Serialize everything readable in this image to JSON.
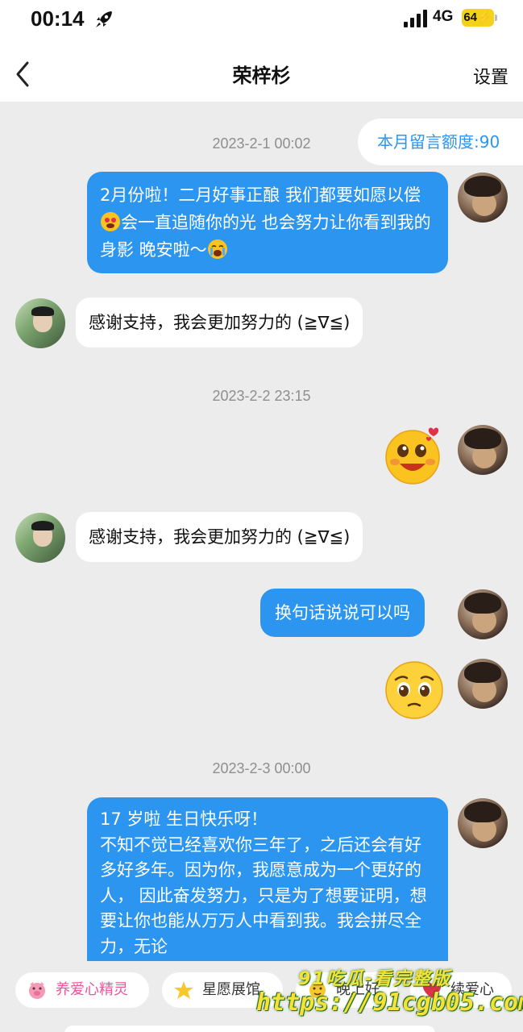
{
  "status_bar": {
    "time": "00:14",
    "network": "4G",
    "battery": "64"
  },
  "nav": {
    "title": "荣梓杉",
    "settings_label": "设置"
  },
  "quota": {
    "label": "本月留言额度:90"
  },
  "timestamps": [
    "2023-2-1 00:02",
    "2023-2-2 23:15",
    "2023-2-3 00:00"
  ],
  "messages": {
    "m1": {
      "part1": "2月份啦！二月好事正酿 我们都要如愿以偿",
      "part2": "会一直追随你的光  也会努力让你看到我的身影  晚安啦～"
    },
    "r1": {
      "text": "感谢支持，我会更加努力的 (≧∇≦)"
    },
    "r2": {
      "text": "感谢支持，我会更加努力的 (≧∇≦)"
    },
    "m3": {
      "text": "换句话说说可以吗"
    },
    "m4": {
      "text": "17 岁啦 生日快乐呀！\n不知不觉已经喜欢你三年了，之后还会有好多好多年。因为你，我愿意成为一个更好的人， 因此奋发努力，只是为了想要证明，想要让你也能从万万人中看到我。我会拼尽全力，无论"
    }
  },
  "toolbar": {
    "chip1": "养爱心精灵",
    "chip2": "星愿展馆",
    "chip3": "晚上好",
    "chip4": "续爱心"
  },
  "watermark": {
    "line1": "91吃瓜-看完整版",
    "line2": "https://91cgb05.com"
  },
  "colors": {
    "accent_blue": "#2b95f0",
    "background": "#ececec",
    "bubble_in": "#ffffff"
  },
  "icons": [
    "rocket-icon",
    "signal-icon",
    "back-arrow-icon",
    "heart-eyes-emoji-icon",
    "crying-emoji-icon",
    "pleading-emoji-icon",
    "pig-icon",
    "star-icon",
    "moon-icon",
    "heart-icon"
  ]
}
